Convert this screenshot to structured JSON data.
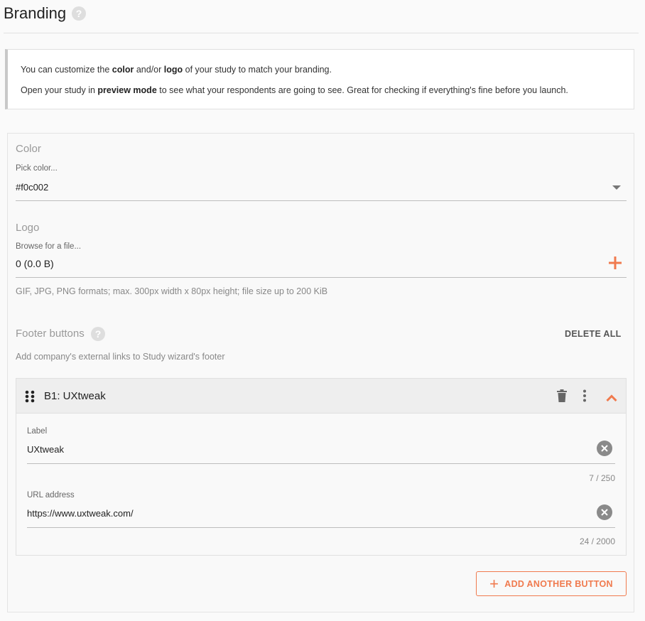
{
  "page": {
    "title": "Branding",
    "help_glyph": "?"
  },
  "info": {
    "line1_prefix": "You can customize the ",
    "line1_color": "color",
    "line1_mid": " and/or ",
    "line1_logo": "logo",
    "line1_suffix": " of your study to match your branding.",
    "line2_prefix": "Open your study in ",
    "line2_bold": "preview mode",
    "line2_suffix": " to see what your respondents are going to see. Great for checking if everything's fine before you launch."
  },
  "color_section": {
    "title": "Color",
    "label": "Pick color...",
    "value": "#f0c002"
  },
  "logo_section": {
    "title": "Logo",
    "label": "Browse for a file...",
    "value": "0 (0.0 B)",
    "hint": "GIF, JPG, PNG formats; max. 300px width x 80px height; file size up to 200 KiB"
  },
  "footer_section": {
    "title": "Footer buttons",
    "help_glyph": "?",
    "delete_all": "DELETE ALL",
    "hint": "Add company's external links to Study wizard's footer",
    "add_button": "ADD ANOTHER BUTTON",
    "add_button_glyph": "+"
  },
  "footer_button": {
    "title": "B1: UXtweak",
    "label_field": {
      "label": "Label",
      "value": "UXtweak",
      "counter": "7 / 250"
    },
    "url_field": {
      "label": "URL address",
      "value": "https://www.uxtweak.com/",
      "counter": "24 / 2000"
    }
  },
  "colors": {
    "accent": "#f07a4e",
    "muted": "#999999",
    "icon": "#8a8a8a"
  }
}
